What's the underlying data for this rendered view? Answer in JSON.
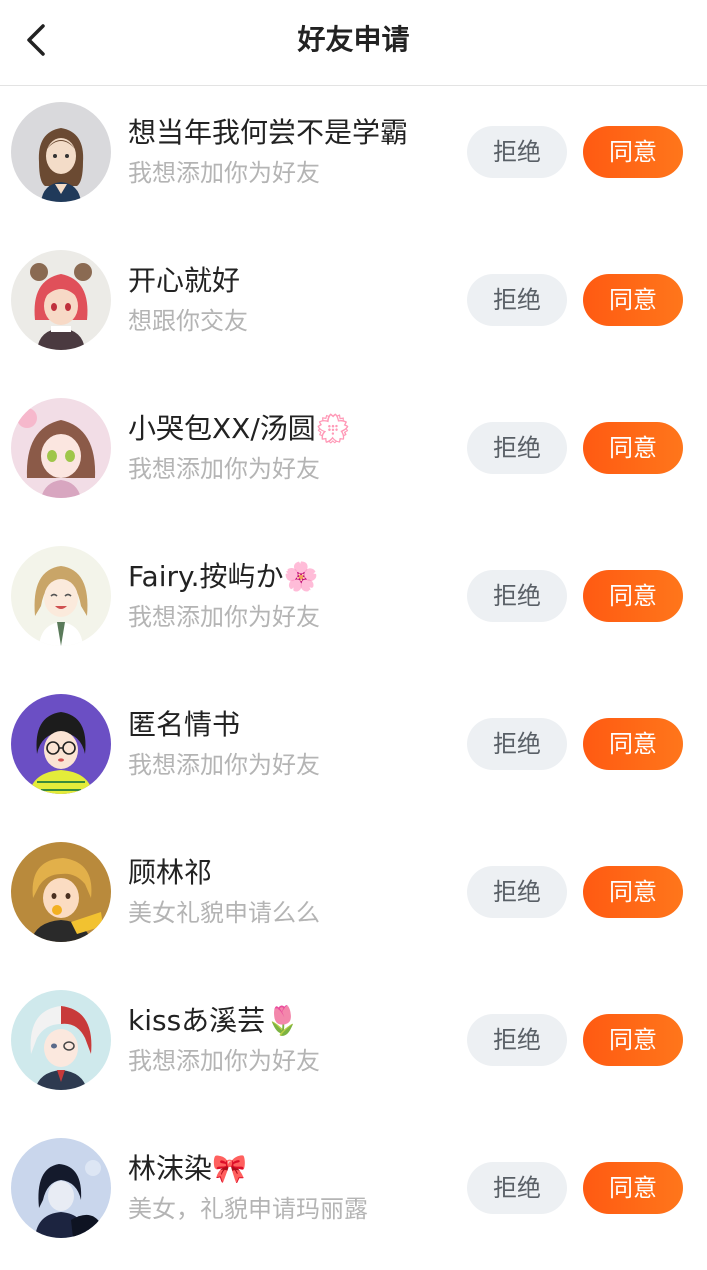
{
  "header": {
    "title": "好友申请",
    "back_icon": "chevron-left-icon"
  },
  "colors": {
    "accent": "#ff6a14",
    "reject_bg": "#edf0f3",
    "subtext": "#b4b4b4"
  },
  "requests": [
    {
      "name": "想当年我何尝不是学霸",
      "message": "我想添加你为好友",
      "reject_label": "拒绝",
      "accept_label": "同意"
    },
    {
      "name": "开心就好",
      "message": "想跟你交友",
      "reject_label": "拒绝",
      "accept_label": "同意"
    },
    {
      "name": "小哭包XX/汤圆💮",
      "message": "我想添加你为好友",
      "reject_label": "拒绝",
      "accept_label": "同意"
    },
    {
      "name": "Fairy.按屿か🌸",
      "message": "我想添加你为好友",
      "reject_label": "拒绝",
      "accept_label": "同意"
    },
    {
      "name": "匿名情书",
      "message": "我想添加你为好友",
      "reject_label": "拒绝",
      "accept_label": "同意"
    },
    {
      "name": "顾林祁",
      "message": "美女礼貌申请么么",
      "reject_label": "拒绝",
      "accept_label": "同意"
    },
    {
      "name": "kissあ溪芸🌷",
      "message": "我想添加你为好友",
      "reject_label": "拒绝",
      "accept_label": "同意"
    },
    {
      "name": "林沫染🎀",
      "message": "美女，礼貌申请玛丽露",
      "reject_label": "拒绝",
      "accept_label": "同意"
    }
  ]
}
